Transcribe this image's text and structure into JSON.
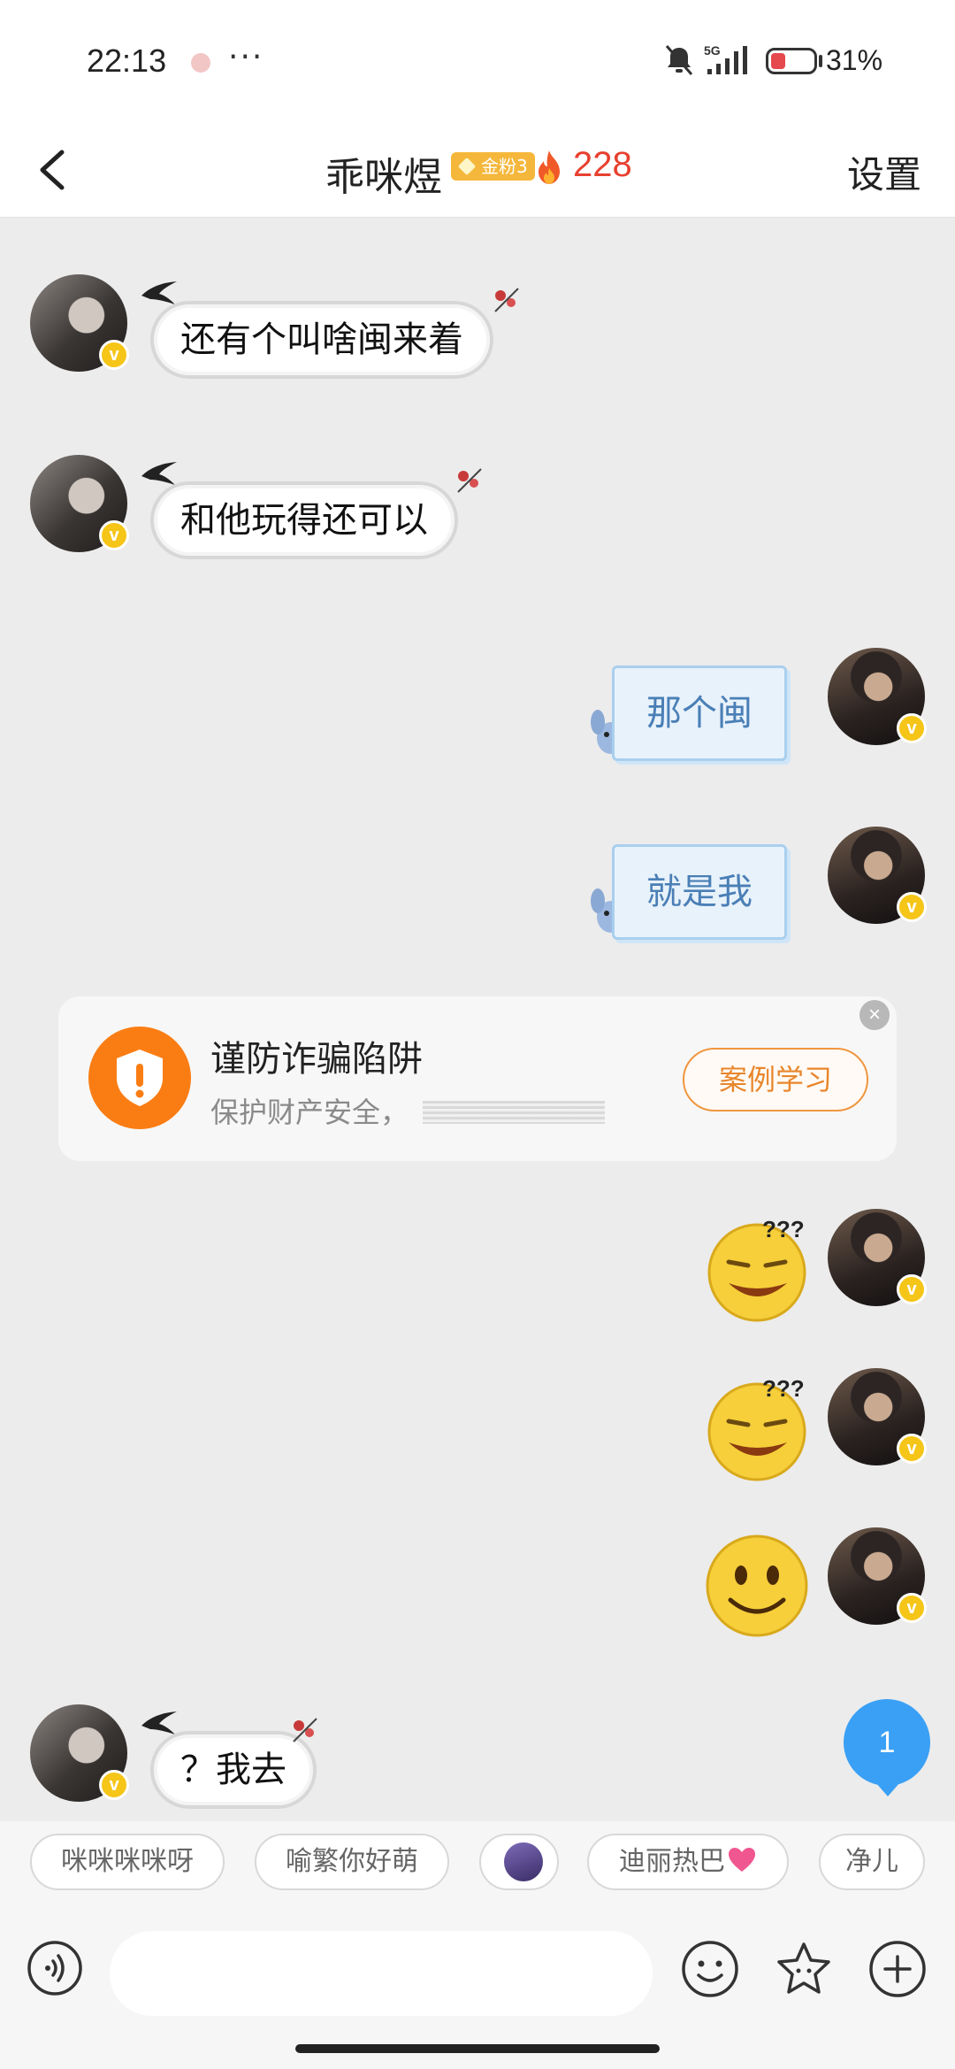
{
  "status_bar": {
    "time": "22:13",
    "more": "···",
    "network": "5G",
    "battery_percent": "31%",
    "battery_level": 0.31
  },
  "header": {
    "title": "乖咪煜",
    "badge": "金粉3",
    "fire_count": "228",
    "settings": "设置"
  },
  "messages": [
    {
      "side": "left",
      "text": "还有个叫啥闽来着"
    },
    {
      "side": "left",
      "text": "和他玩得还可以"
    },
    {
      "side": "right",
      "text": "那个闽"
    },
    {
      "side": "right",
      "text": "就是我"
    },
    {
      "side": "right",
      "emoji": "confused-grin-emoji"
    },
    {
      "side": "right",
      "emoji": "confused-grin-emoji"
    },
    {
      "side": "right",
      "emoji": "smile-emoji"
    },
    {
      "side": "left",
      "text": "？我去"
    }
  ],
  "fraud_notice": {
    "title": "谨防诈骗陷阱",
    "subtitle": "保护财产安全，",
    "button": "案例学习",
    "close": "×"
  },
  "unread_count": "1",
  "quick_replies": [
    "咪咪咪咪呀",
    "喻繁你好萌",
    "迪丽热巴",
    "净儿"
  ],
  "input": {
    "value": "",
    "placeholder": ""
  },
  "icons": {
    "back": "chevron-left-icon",
    "flame": "flame-icon",
    "voice": "voice-icon",
    "emoji": "emoji-icon",
    "sticker": "star-sticker-icon",
    "add": "plus-icon"
  },
  "colors": {
    "accent_blue": "#3aa0f5",
    "fire_red": "#e8402f",
    "fraud_orange": "#fa7d14"
  }
}
